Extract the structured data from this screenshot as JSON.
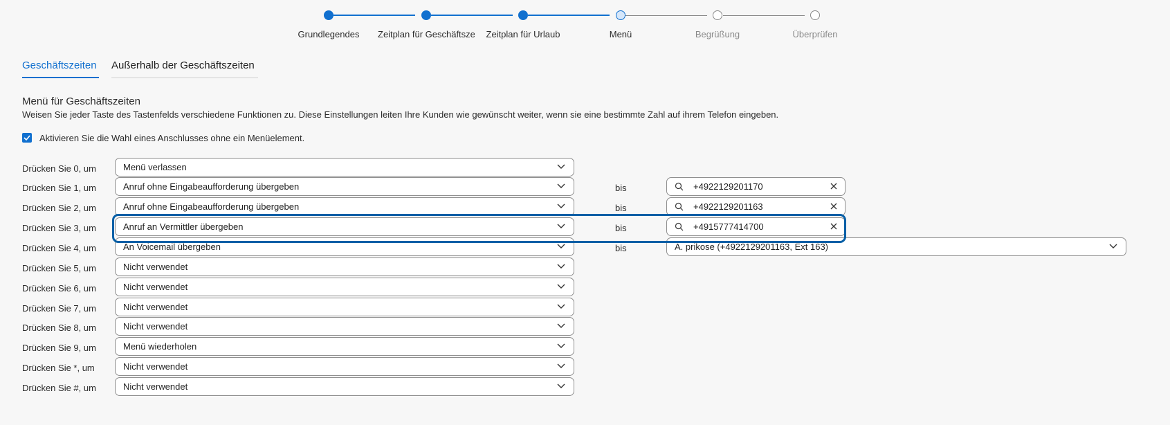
{
  "stepper": {
    "steps": [
      {
        "label": "Grundlegendes",
        "state": "done"
      },
      {
        "label": "Zeitplan für Geschäftszeiten",
        "state": "done"
      },
      {
        "label": "Zeitplan für Urlaub",
        "state": "done"
      },
      {
        "label": "Menü",
        "state": "current"
      },
      {
        "label": "Begrüßung",
        "state": "pending"
      },
      {
        "label": "Überprüfen",
        "state": "pending"
      }
    ]
  },
  "tabs": [
    {
      "label": "Geschäftszeiten",
      "active": true
    },
    {
      "label": "Außerhalb der Geschäftszeiten",
      "active": false
    }
  ],
  "section": {
    "title": "Menü für Geschäftszeiten",
    "description": "Weisen Sie jeder Taste des Tastenfelds verschiedene Funktionen zu. Diese Einstellungen leiten Ihre Kunden wie gewünscht weiter, wenn sie eine bestimmte Zahl auf ihrem Telefon eingeben."
  },
  "checkbox": {
    "label": "Aktivieren Sie die Wahl eines Anschlusses ohne ein Menüelement.",
    "checked": true
  },
  "bis_label": "bis",
  "rows": [
    {
      "label": "Drücken Sie 0, um",
      "action": "Menü verlassen"
    },
    {
      "label": "Drücken Sie 1, um",
      "action": "Anruf ohne Eingabeaufforderung übergeben",
      "target": "+4922129201170"
    },
    {
      "label": "Drücken Sie 2, um",
      "action": "Anruf ohne Eingabeaufforderung übergeben",
      "target": "+4922129201163"
    },
    {
      "label": "Drücken Sie 3, um",
      "action": "Anruf an Vermittler übergeben",
      "target": "+4915777414700"
    },
    {
      "label": "Drücken Sie 4, um",
      "action": "An Voicemail übergeben",
      "target_select": "A. prikose (+4922129201163, Ext 163)"
    },
    {
      "label": "Drücken Sie 5, um",
      "action": "Nicht verwendet"
    },
    {
      "label": "Drücken Sie 6, um",
      "action": "Nicht verwendet"
    },
    {
      "label": "Drücken Sie 7, um",
      "action": "Nicht verwendet"
    },
    {
      "label": "Drücken Sie 8, um",
      "action": "Nicht verwendet"
    },
    {
      "label": "Drücken Sie 9, um",
      "action": "Menü wiederholen"
    },
    {
      "label": "Drücken Sie *, um",
      "action": "Nicht verwendet"
    },
    {
      "label": "Drücken Sie #, um",
      "action": "Nicht verwendet"
    }
  ],
  "colors": {
    "accent": "#1170cf",
    "highlight": "#075fa6",
    "pending": "#8a8a8a"
  },
  "icons": {
    "dropdown": "chevron-down-icon",
    "search": "search-icon",
    "clear": "close-icon",
    "check": "check-icon"
  }
}
